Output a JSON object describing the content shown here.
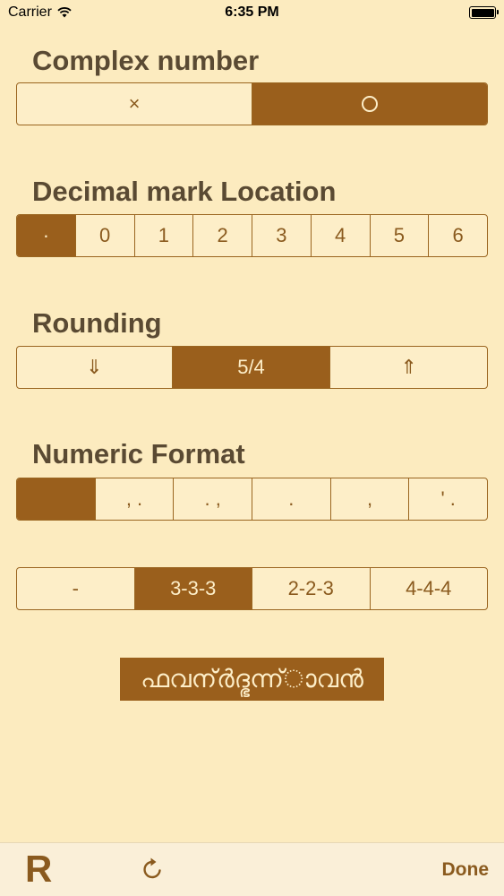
{
  "status_bar": {
    "carrier": "Carrier",
    "time": "6:35 PM"
  },
  "complex_number": {
    "title": "Complex number",
    "options": [
      "×",
      "○"
    ],
    "selected_index": 1
  },
  "decimal_mark": {
    "title": "Decimal mark Location",
    "options": [
      "·",
      "0",
      "1",
      "2",
      "3",
      "4",
      "5",
      "6"
    ],
    "selected_index": 0
  },
  "rounding": {
    "title": "Rounding",
    "options": [
      "⇓",
      "5/4",
      "⇑"
    ],
    "selected_index": 1
  },
  "numeric_format": {
    "title": "Numeric Format",
    "options": [
      "",
      ", .",
      ". ,",
      ".",
      ",",
      "' ."
    ],
    "selected_index": 0
  },
  "grouping": {
    "options": [
      "-",
      "3-3-3",
      "2-2-3",
      "4-4-4"
    ],
    "selected_index": 1
  },
  "action_button": {
    "label": "ഫവന്ർദ്ഭന്ന്ാവൻ"
  },
  "toolbar": {
    "logo": "R",
    "done_label": "Done"
  },
  "colors": {
    "background": "#fcebbf",
    "accent": "#9a5f1c",
    "text": "#5a4a33"
  }
}
